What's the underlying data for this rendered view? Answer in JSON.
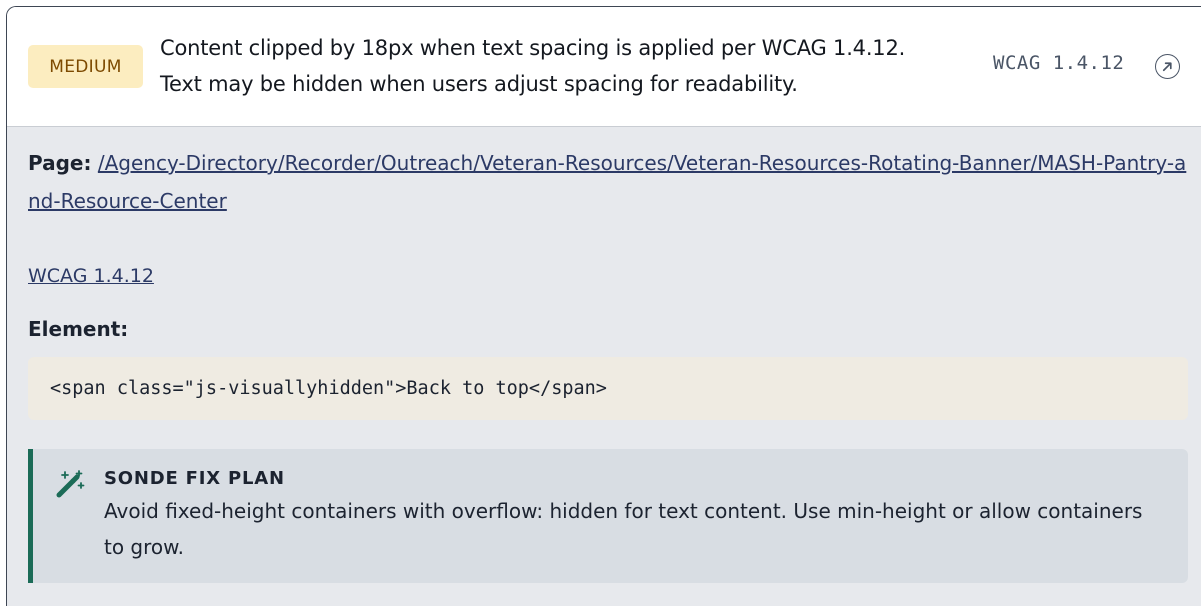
{
  "issue": {
    "severity": "MEDIUM",
    "message_line1": "Content clipped by 18px when text spacing is applied per WCAG 1.4.12.",
    "message_line2": "Text may be hidden when users adjust spacing for readability.",
    "wcag_code": "WCAG 1.4.12",
    "link_icon": "external-link-icon",
    "severity_color": "#fcedc0"
  },
  "details": {
    "page_label": "Page:",
    "page_path": "/Agency-Directory/Recorder/Outreach/Veteran-Resources/Veteran-Resources-Rotating-Banner/MASH-Pantry-and-Resource-Center",
    "wcag_link": "WCAG 1.4.12",
    "element_label": "Element:",
    "element_code": "<span class=\"js-visuallyhidden\">Back to top</span>"
  },
  "fix_plan": {
    "icon": "magic-wand-icon",
    "title": "SONDE FIX PLAN",
    "text": "Avoid fixed-height containers with overflow: hidden for text content. Use min-height or allow containers to grow.",
    "accent_color": "#1b6b57"
  }
}
